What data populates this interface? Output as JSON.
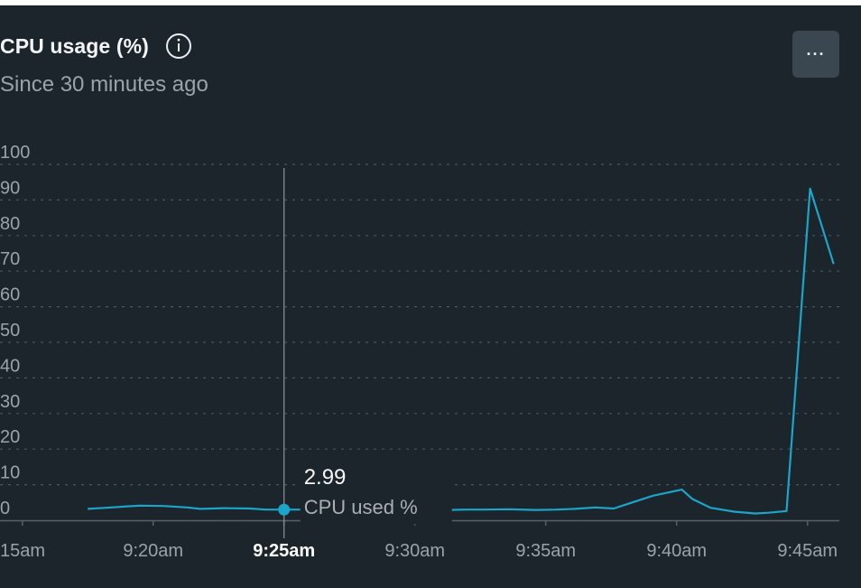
{
  "header": {
    "title": "CPU usage (%)",
    "subtitle": "Since 30 minutes ago",
    "menu_label": "···"
  },
  "colors": {
    "background": "#1d252c",
    "series": "#1ba5c8",
    "grid": "#4a555e",
    "axis_text": "#9aa3a9",
    "hover_line": "#8a949b"
  },
  "icons": {
    "info": "info-circle-icon",
    "menu": "more-horizontal-icon"
  },
  "chart_data": {
    "type": "line",
    "title": "CPU usage (%)",
    "subtitle": "Since 30 minutes ago",
    "y_ticks": [
      "0",
      "10",
      "20",
      "30",
      "40",
      "50",
      "60",
      "70",
      "80",
      "90",
      "100"
    ],
    "ylim": [
      0,
      100
    ],
    "x_ticks": [
      "15am",
      "9:20am",
      "9:25am",
      "9:30am",
      "9:35am",
      "9:40am",
      "9:45am"
    ],
    "x_tick_minutes": [
      15,
      20,
      25,
      30,
      35,
      40,
      45
    ],
    "grid": true,
    "series": [
      {
        "name": "CPU used %",
        "x": [
          17.5,
          18.2,
          19.0,
          19.5,
          20.4,
          21.3,
          21.8,
          22.7,
          23.7,
          24.3,
          25.0,
          25.8,
          26.4,
          27.2,
          28.1,
          28.8,
          30.2,
          31.3,
          31.9,
          32.6,
          33.6,
          34.6,
          35.4,
          36.1,
          36.9,
          37.6,
          38.3,
          39.1,
          40.2,
          40.6,
          41.3,
          42.2,
          43.0,
          43.5,
          44.2,
          45.1,
          46.0
        ],
        "y": [
          3.2,
          3.5,
          3.9,
          4.1,
          4.0,
          3.6,
          3.2,
          3.4,
          3.3,
          3.0,
          2.99,
          3.0,
          3.1,
          2.7,
          2.9,
          2.6,
          2.8,
          2.9,
          3.0,
          3.0,
          3.1,
          2.9,
          3.0,
          3.2,
          3.6,
          3.3,
          5.0,
          6.9,
          8.6,
          6.0,
          3.5,
          2.4,
          1.9,
          2.1,
          2.6,
          93.2,
          72.0
        ]
      }
    ],
    "hover": {
      "x_label": "9:25am",
      "x": 25.0,
      "value": "2.99",
      "series_label": "CPU used %"
    }
  }
}
